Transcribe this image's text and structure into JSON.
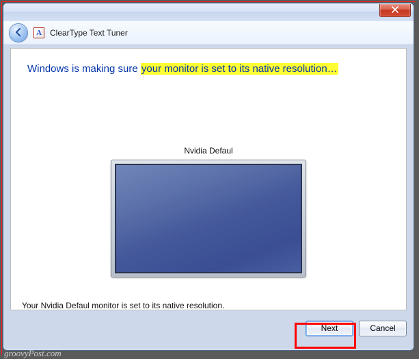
{
  "titlebar": {
    "close_tooltip": "Close"
  },
  "navbar": {
    "back_tooltip": "Back",
    "app_icon_letter": "A",
    "app_title": "ClearType Text Tuner"
  },
  "heading": {
    "plain": "Windows is making sure ",
    "highlight": "your monitor is set to its native resolution…"
  },
  "monitor": {
    "label": "Nvidia Defaul"
  },
  "status": {
    "text": "Your Nvidia Defaul monitor is set to its native resolution."
  },
  "buttons": {
    "next": "Next",
    "cancel": "Cancel"
  },
  "watermark": "groovyPost.com"
}
